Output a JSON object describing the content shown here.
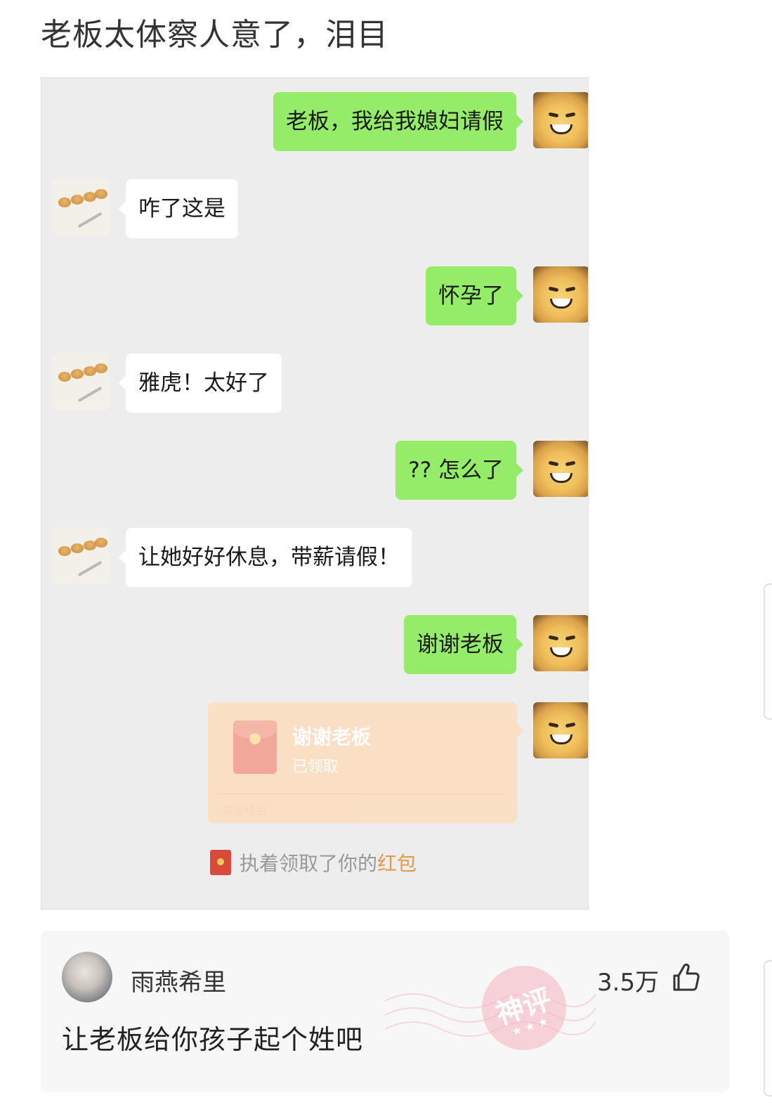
{
  "post": {
    "title": "老板太体察人意了，泪目"
  },
  "chat": {
    "messages": [
      {
        "from": "me",
        "text": "老板，我给我媳妇请假"
      },
      {
        "from": "boss",
        "text": "咋了这是"
      },
      {
        "from": "me",
        "text": "怀孕了"
      },
      {
        "from": "boss",
        "text": "雅虎！太好了"
      },
      {
        "from": "me",
        "text": "?? 怎么了"
      },
      {
        "from": "boss",
        "text": "让她好好休息，带薪请假！"
      },
      {
        "from": "me",
        "text": "谢谢老板"
      }
    ],
    "red_packet": {
      "title": "谢谢老板",
      "status": "已领取",
      "footer": "微信红包"
    },
    "system_note": {
      "prefix": "执着领取了你的",
      "highlight": "红包"
    }
  },
  "comment": {
    "username": "雨燕希里",
    "likes": "3.5万",
    "text": "让老板给你孩子起个姓吧",
    "badge": "神评"
  },
  "colors": {
    "my_bubble": "#95ec69",
    "boss_bubble": "#ffffff",
    "chat_bg": "#ededed",
    "red_packet_bg": "#fbdfc3",
    "highlight": "#e39a4a"
  },
  "icons": {
    "like": "thumbs-up-icon",
    "badge": "god-comment-stamp-icon",
    "mini_red_packet": "red-packet-icon"
  }
}
